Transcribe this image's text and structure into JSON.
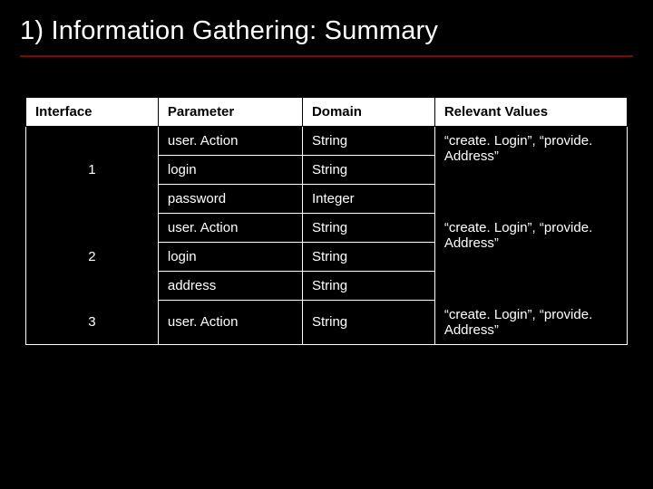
{
  "title": "1) Information Gathering: Summary",
  "headers": {
    "interface": "Interface",
    "parameter": "Parameter",
    "domain": "Domain",
    "relevant": "Relevant Values"
  },
  "groups": [
    {
      "interface": "1",
      "relevant": "“create. Login”, “provide. Address”",
      "rows": [
        {
          "parameter": "user. Action",
          "domain": "String"
        },
        {
          "parameter": "login",
          "domain": "String"
        },
        {
          "parameter": "password",
          "domain": "Integer"
        }
      ]
    },
    {
      "interface": "2",
      "relevant": "“create. Login”, “provide. Address”",
      "rows": [
        {
          "parameter": "user. Action",
          "domain": "String"
        },
        {
          "parameter": "login",
          "domain": "String"
        },
        {
          "parameter": "address",
          "domain": "String"
        }
      ]
    },
    {
      "interface": "3",
      "relevant": "“create. Login”, “provide. Address”",
      "rows": [
        {
          "parameter": "user. Action",
          "domain": "String"
        }
      ]
    }
  ]
}
